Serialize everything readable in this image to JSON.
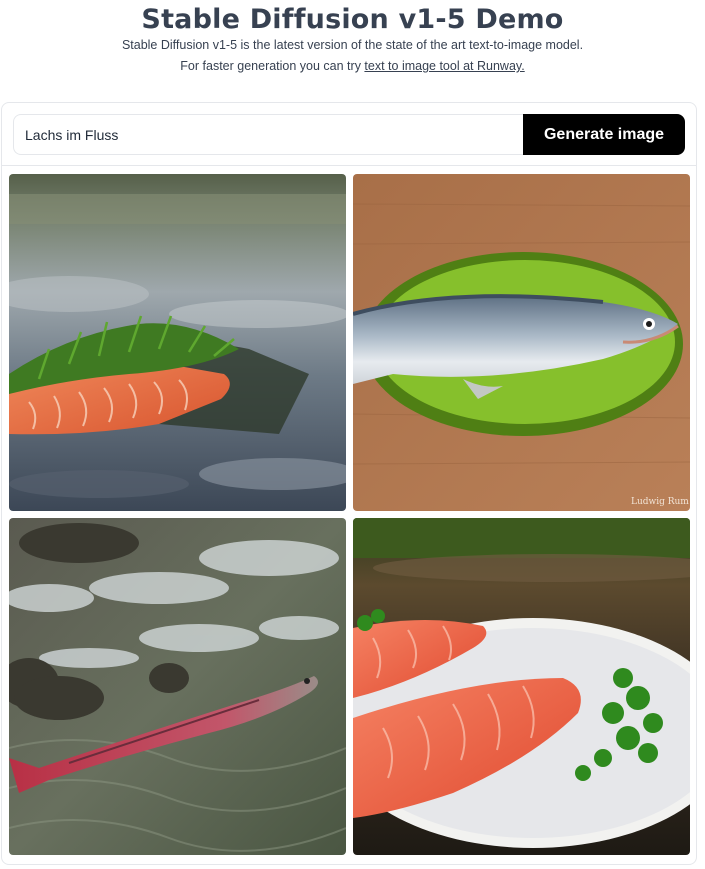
{
  "header": {
    "title": "Stable Diffusion v1-5 Demo",
    "subtitle_line1": "Stable Diffusion v1-5 is the latest version of the state of the art text-to-image model.",
    "subtitle_line2_prefix": "For faster generation you can try ",
    "subtitle_link": "text to image tool at Runway."
  },
  "prompt": {
    "value": "Lachs im Fluss"
  },
  "generate_button": {
    "label": "Generate image"
  },
  "gallery": {
    "images": [
      {
        "name": "salmon-fillet-with-dill-on-river-rock"
      },
      {
        "name": "whole-salmon-on-green-plate"
      },
      {
        "name": "salmon-swimming-in-rapids"
      },
      {
        "name": "salmon-fillets-on-white-plate"
      }
    ],
    "watermark": "Ludwig Rum"
  }
}
